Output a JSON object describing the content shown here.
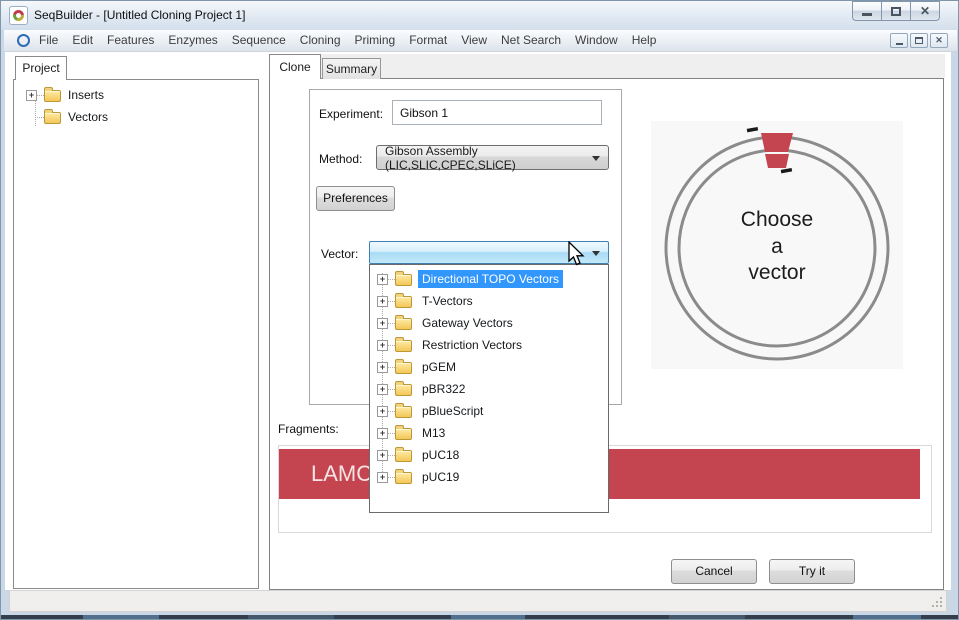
{
  "window": {
    "title": "SeqBuilder - [Untitled Cloning Project 1]"
  },
  "menubar": {
    "items": [
      "File",
      "Edit",
      "Features",
      "Enzymes",
      "Sequence",
      "Cloning",
      "Priming",
      "Format",
      "View",
      "Net Search",
      "Window",
      "Help"
    ]
  },
  "project_panel": {
    "tab_label": "Project",
    "tree": [
      {
        "label": "Inserts"
      },
      {
        "label": "Vectors"
      }
    ]
  },
  "clone_view": {
    "tabs": [
      "Clone",
      "Summary"
    ],
    "active_tab": "Clone",
    "experiment_label": "Experiment:",
    "experiment_value": "Gibson 1",
    "method_label": "Method:",
    "method_value": "Gibson Assembly (LIC,SLIC,CPEC,SLiCE)",
    "preferences_button": "Preferences",
    "vector_label": "Vector:",
    "vector_value": "",
    "dropdown": {
      "selected": "Directional TOPO Vectors",
      "items": [
        "Directional TOPO Vectors",
        "T-Vectors",
        "Gateway Vectors",
        "Restriction Vectors",
        "pGEM",
        "pBR322",
        "pBlueScript",
        "M13",
        "pUC18",
        "pUC19"
      ]
    },
    "plasmid_caption": {
      "line1": "Choose",
      "line2": "a",
      "line3": "vector"
    },
    "fragments_label": "Fragments:",
    "fragment_bar_text": "LAMC",
    "cancel_button": "Cancel",
    "try_button": "Try it"
  },
  "icons": {
    "expander": "+",
    "close": "✕"
  },
  "colors": {
    "fragment_red": "#c4444f",
    "selection_blue": "#3297fd",
    "plasmid_ring_gray": "#8b8b8b"
  }
}
